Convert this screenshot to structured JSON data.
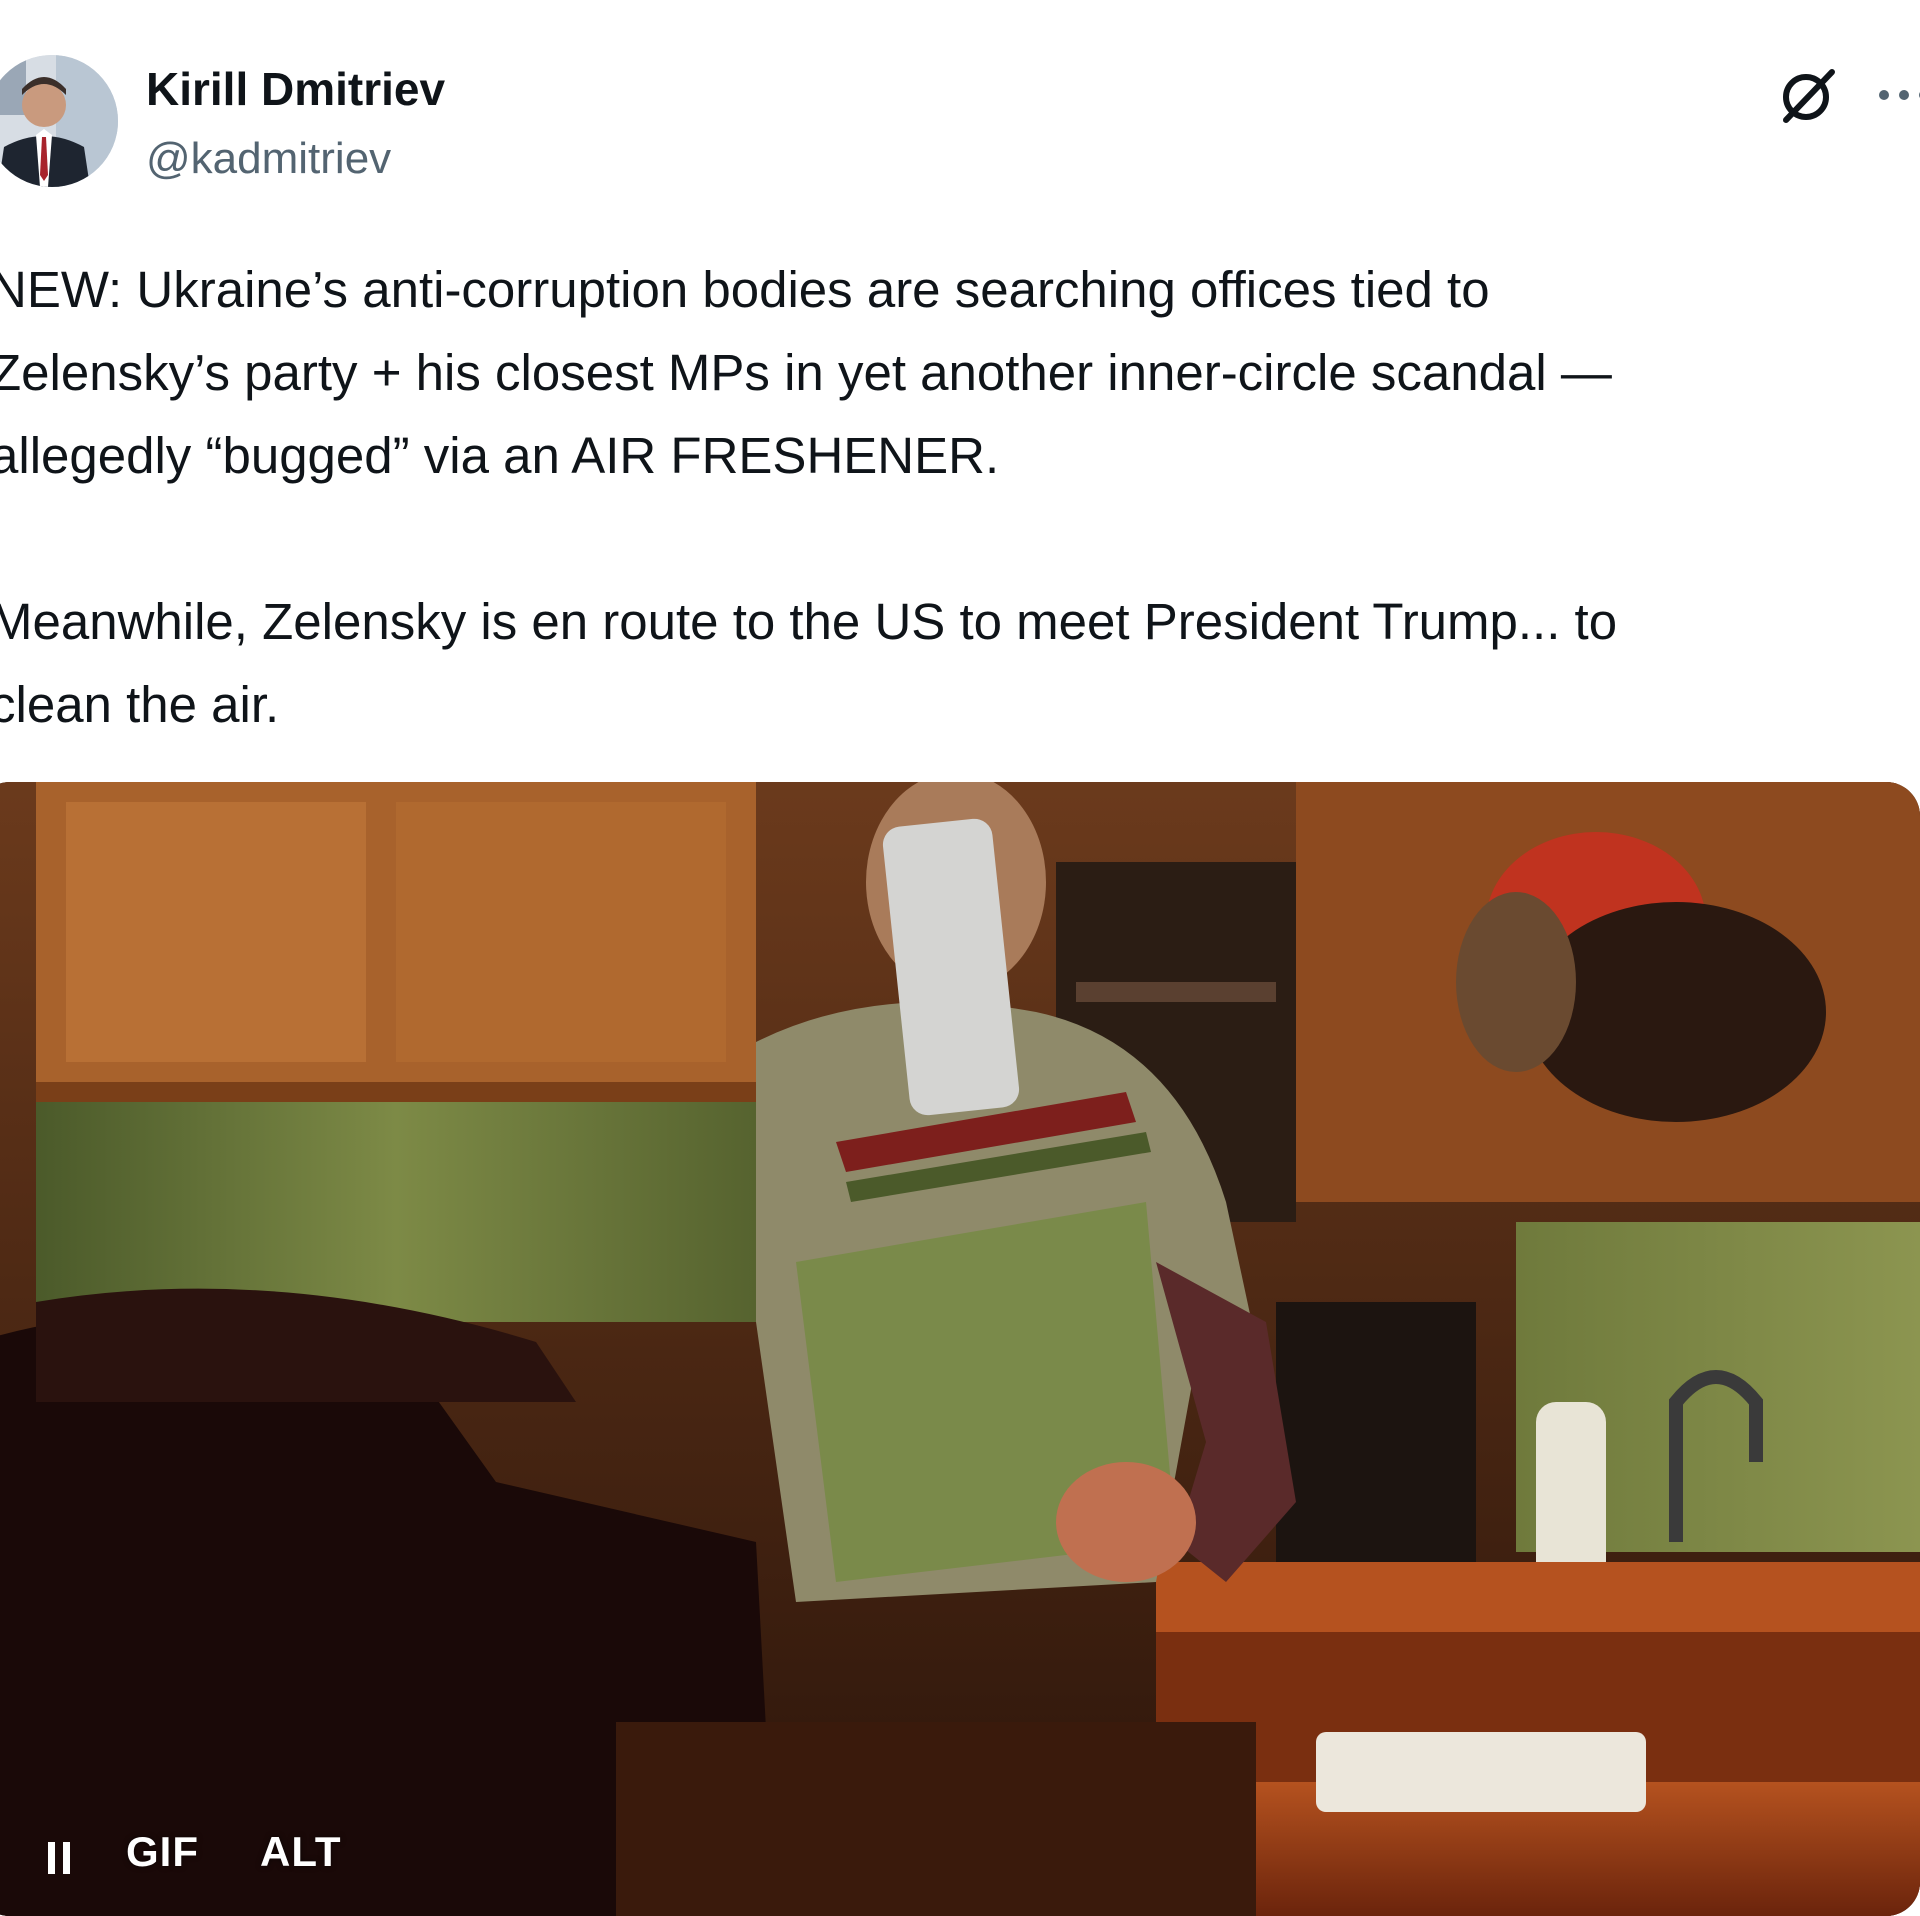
{
  "author": {
    "display_name": "Kirill Dmitriev",
    "handle": "@kadmitriev"
  },
  "header_icons": {
    "grok": "grok-icon",
    "more": "more-icon"
  },
  "tweet": {
    "text": "NEW: Ukraine’s anti-corruption bodies are searching offices tied to\nZelensky’s party + his closest MPs in yet another inner-circle scandal —\nallegedly “bugged” via an AIR FRESHENER.\n\nMeanwhile, Zelensky is en route to the US to meet President Trump... to\nclean the air."
  },
  "media": {
    "type": "gif",
    "pause_icon": "pause-icon",
    "gif_label": "GIF",
    "alt_label": "ALT"
  },
  "colors": {
    "text_primary": "#0f1419",
    "text_secondary": "#536471",
    "background": "#ffffff"
  }
}
